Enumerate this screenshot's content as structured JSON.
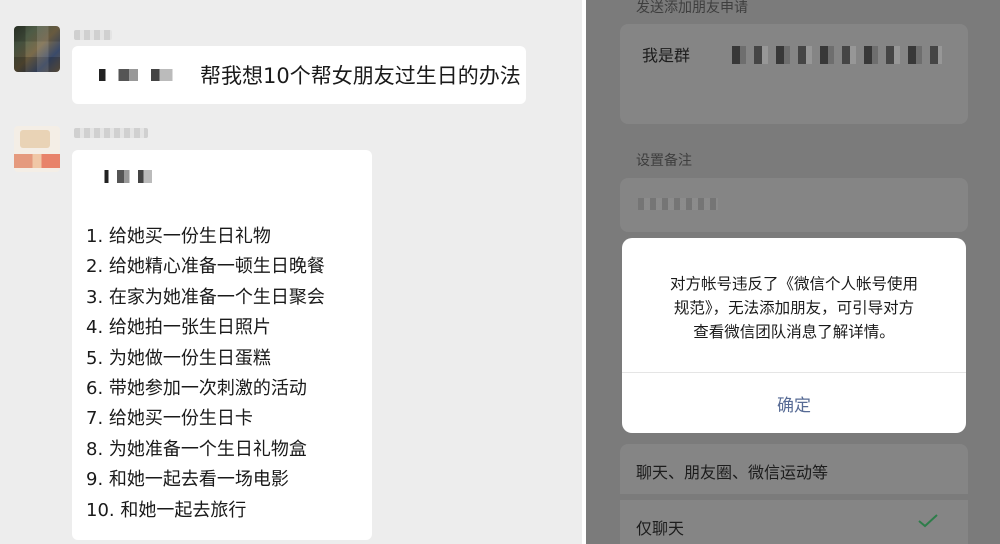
{
  "chat": {
    "messages": [
      {
        "sender": "user",
        "text": "帮我想10个帮女朋友过生日的办法"
      },
      {
        "sender": "bot",
        "items": [
          "1. 给她买一份生日礼物",
          "2. 给她精心准备一顿生日晚餐",
          "3. 在家为她准备一个生日聚会",
          "4. 给她拍一张生日照片",
          "5. 为她做一份生日蛋糕",
          "6. 带她参加一次刺激的活动",
          "7. 给她买一份生日卡",
          "8. 为她准备一个生日礼物盒",
          "9. 和她一起去看一场电影",
          "10. 和她一起去旅行"
        ]
      }
    ]
  },
  "friend_request": {
    "send_label": "发送添加朋友申请",
    "request_prefix": "我是群",
    "remark_label": "设置备注",
    "permissions": [
      {
        "label": "聊天、朋友圈、微信运动等",
        "checked": false
      },
      {
        "label": "仅聊天",
        "checked": true
      }
    ]
  },
  "dialog": {
    "message_lines": [
      "对方帐号违反了《微信个人帐号使用",
      "规范》，无法添加朋友，可引导对方",
      "查看微信团队消息了解详情。"
    ],
    "confirm_label": "确定",
    "confirm_color": "#576b95"
  },
  "colors": {
    "chat_background": "#ededed",
    "overlay_background": "#7b7b7b",
    "check_color": "#3cb371"
  }
}
